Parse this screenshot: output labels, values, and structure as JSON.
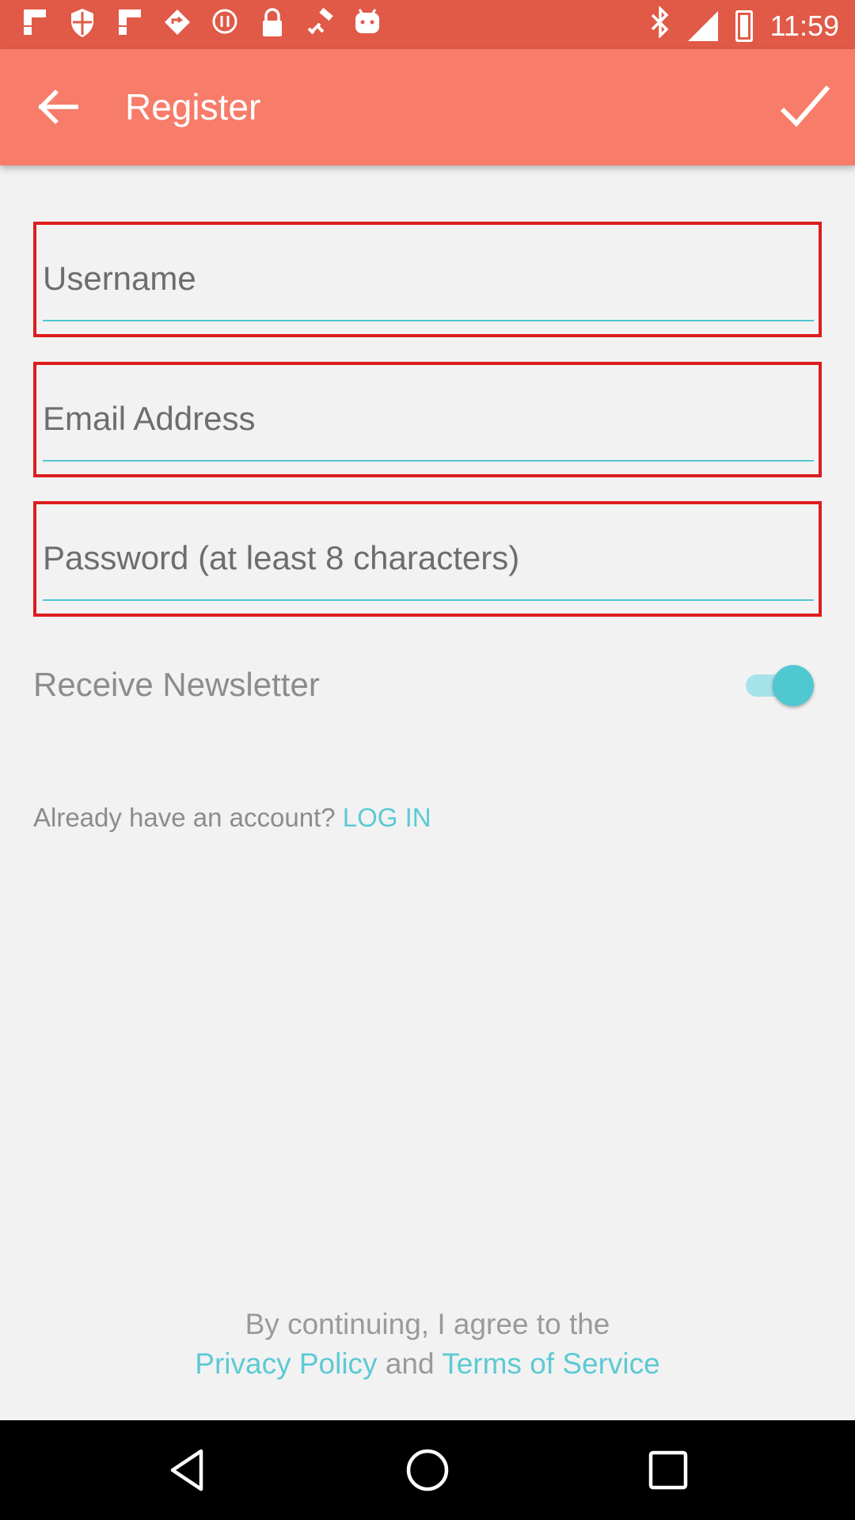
{
  "status_bar": {
    "time": "11:59",
    "left_icons": [
      "flipboard-icon",
      "shield-icon",
      "flipboard-icon",
      "location-icon",
      "record-icon",
      "lock-icon",
      "satellite-icon",
      "android-icon"
    ],
    "right_icons": [
      "bluetooth-icon",
      "signal-icon",
      "battery-icon"
    ]
  },
  "app_bar": {
    "title": "Register",
    "back_icon": "arrow-back-icon",
    "confirm_icon": "check-icon"
  },
  "form": {
    "username_placeholder": "Username",
    "email_placeholder": "Email Address",
    "password_placeholder": "Password (at least 8 characters)"
  },
  "newsletter": {
    "label": "Receive Newsletter",
    "enabled": true
  },
  "login_prompt": {
    "text": "Already have an account?",
    "link": "LOG IN"
  },
  "terms": {
    "line1": "By continuing, I agree to the",
    "privacy": "Privacy Policy",
    "and": "and",
    "tos": "Terms of Service"
  },
  "colors": {
    "status_bar": "#e05a47",
    "app_bar": "#f77c69",
    "accent": "#4fc8d1",
    "field_border": "#dd1d1d",
    "background": "#f2f2f2"
  }
}
